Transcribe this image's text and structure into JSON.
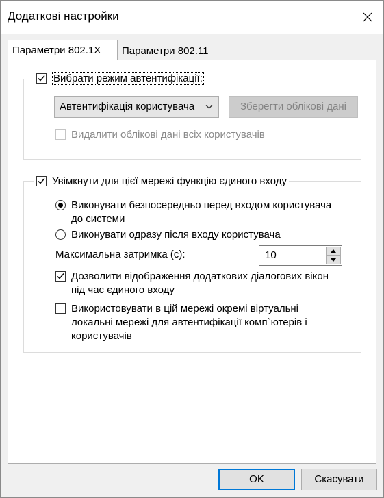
{
  "window": {
    "title": "Додаткові настройки"
  },
  "tabs": [
    {
      "label": "Параметри 802.1X"
    },
    {
      "label": "Параметри 802.11"
    }
  ],
  "auth_group": {
    "checkbox_label": "Вибрати режим автентифікації:",
    "checked": true,
    "mode_select_value": "Автентифікація користувача",
    "save_credentials_button": "Зберегти облікові дані",
    "delete_credentials_label": "Видалити облікові дані всіх користувачів",
    "delete_credentials_checked": false
  },
  "sso_group": {
    "checkbox_label": "Увімкнути для цієї мережі функцію єдиного входу",
    "checked": true,
    "radio_before_line1": "Виконувати безпосередньо перед входом користувача",
    "radio_before_line2": "до системи",
    "radio_after": "Виконувати одразу після входу користувача",
    "selected_radio": "before",
    "max_delay_label": "Максимальна затримка (с):",
    "max_delay_value": "10",
    "allow_dialogs_line1": "Дозволити відображення додаткових діалогових вікон",
    "allow_dialogs_line2": "під час єдиного входу",
    "allow_dialogs_checked": true,
    "vlan_line1": "Використовувати в цій мережі окремі віртуальні",
    "vlan_line2": "локальні мережі для автентифікації комп`ютерів і",
    "vlan_line3": "користувачів",
    "vlan_checked": false
  },
  "footer": {
    "ok": "OK",
    "cancel": "Скасувати"
  },
  "colors": {
    "default_button_border": "#0078d7",
    "background": "#f0f0f0"
  },
  "icons": [
    "close-icon",
    "checkmark-icon",
    "chevron-down-icon",
    "spin-up-icon",
    "spin-down-icon"
  ]
}
